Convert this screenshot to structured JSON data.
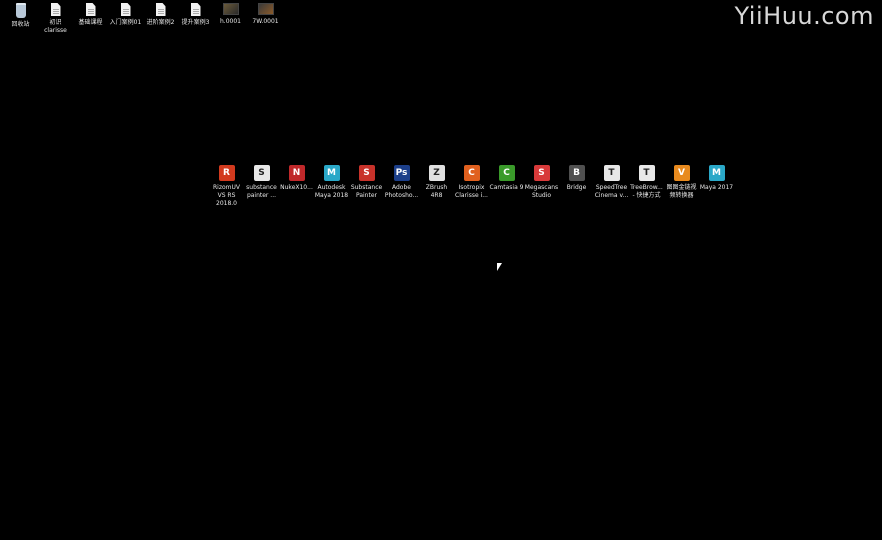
{
  "watermark": "YiiHuu.com",
  "top_icons": [
    {
      "label": "回收站",
      "icon": "recycle-bin-icon"
    },
    {
      "label": "初识clarisse",
      "icon": "document-icon"
    },
    {
      "label": "基础课程",
      "icon": "document-icon"
    },
    {
      "label": "入门案例01",
      "icon": "document-icon"
    },
    {
      "label": "进阶案例2",
      "icon": "document-icon"
    },
    {
      "label": "提升案例3",
      "icon": "document-icon"
    },
    {
      "label": "h.0001",
      "icon": "image-thumbnail-icon"
    },
    {
      "label": "7W.0001",
      "icon": "image-thumbnail-icon"
    }
  ],
  "app_icons": [
    {
      "label": "RizomUV VS RS 2018.0",
      "icon": "rizomuv-icon",
      "color": "#d23a1e",
      "glyph": "R"
    },
    {
      "label": "substance painter ...",
      "icon": "substance-painter-file-icon",
      "color": "#e8e8e8",
      "glyph": "S"
    },
    {
      "label": "NukeX10...",
      "icon": "nukex-icon",
      "color": "#c0282a",
      "glyph": "N"
    },
    {
      "label": "Autodesk Maya 2018",
      "icon": "maya-icon",
      "color": "#2aa8c8",
      "glyph": "M"
    },
    {
      "label": "Substance Painter",
      "icon": "substance-painter-icon",
      "color": "#c8322a",
      "glyph": "S"
    },
    {
      "label": "Adobe Photosho...",
      "icon": "photoshop-icon",
      "color": "#1c3f8a",
      "glyph": "Ps"
    },
    {
      "label": "ZBrush 4R8",
      "icon": "zbrush-icon",
      "color": "#e0e0e0",
      "glyph": "Z"
    },
    {
      "label": "Isotropix Clarisse i...",
      "icon": "clarisse-icon",
      "color": "#e0601e",
      "glyph": "C"
    },
    {
      "label": "Camtasia 9",
      "icon": "camtasia-icon",
      "color": "#3a9a2a",
      "glyph": "C"
    },
    {
      "label": "Megascans Studio",
      "icon": "megascans-icon",
      "color": "#d83a3a",
      "glyph": "S"
    },
    {
      "label": "Bridge",
      "icon": "bridge-icon",
      "color": "#505050",
      "glyph": "B"
    },
    {
      "label": "SpeedTree Cinema v...",
      "icon": "speedtree-icon",
      "color": "#e8e8e8",
      "glyph": "T"
    },
    {
      "label": "TreeBrow... - 快捷方式",
      "icon": "treebrowser-icon",
      "color": "#e8e8e8",
      "glyph": "T"
    },
    {
      "label": "图图金链视频转换器",
      "icon": "video-converter-icon",
      "color": "#e88a1e",
      "glyph": "V"
    },
    {
      "label": "Maya 2017",
      "icon": "maya-icon",
      "color": "#2aa8c8",
      "glyph": "M"
    }
  ]
}
